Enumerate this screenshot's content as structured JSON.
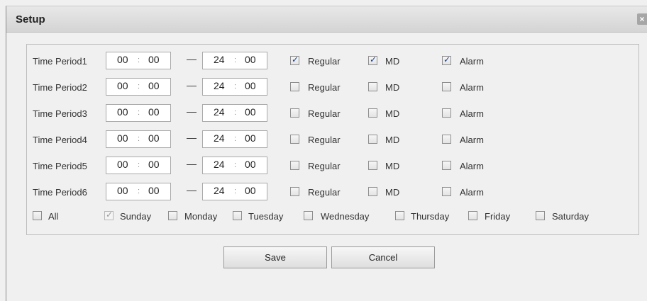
{
  "dialog": {
    "title": "Setup",
    "close_glyph": "×"
  },
  "time_periods": [
    {
      "label": "Time Period1",
      "start_h": "00",
      "start_m": "00",
      "end_h": "24",
      "end_m": "00",
      "regular": true,
      "md": true,
      "alarm": true
    },
    {
      "label": "Time Period2",
      "start_h": "00",
      "start_m": "00",
      "end_h": "24",
      "end_m": "00",
      "regular": false,
      "md": false,
      "alarm": false
    },
    {
      "label": "Time Period3",
      "start_h": "00",
      "start_m": "00",
      "end_h": "24",
      "end_m": "00",
      "regular": false,
      "md": false,
      "alarm": false
    },
    {
      "label": "Time Period4",
      "start_h": "00",
      "start_m": "00",
      "end_h": "24",
      "end_m": "00",
      "regular": false,
      "md": false,
      "alarm": false
    },
    {
      "label": "Time Period5",
      "start_h": "00",
      "start_m": "00",
      "end_h": "24",
      "end_m": "00",
      "regular": false,
      "md": false,
      "alarm": false
    },
    {
      "label": "Time Period6",
      "start_h": "00",
      "start_m": "00",
      "end_h": "24",
      "end_m": "00",
      "regular": false,
      "md": false,
      "alarm": false
    }
  ],
  "labels": {
    "regular": "Regular",
    "md": "MD",
    "alarm": "Alarm",
    "time_sep": ":",
    "range_dash": "—"
  },
  "days": {
    "all": {
      "label": "All",
      "checked": false
    },
    "list": [
      {
        "label": "Sunday",
        "checked": true,
        "disabled": true
      },
      {
        "label": "Monday",
        "checked": false,
        "disabled": false
      },
      {
        "label": "Tuesday",
        "checked": false,
        "disabled": false
      },
      {
        "label": "Wednesday",
        "checked": false,
        "disabled": false
      },
      {
        "label": "Thursday",
        "checked": false,
        "disabled": false
      },
      {
        "label": "Friday",
        "checked": false,
        "disabled": false
      },
      {
        "label": "Saturday",
        "checked": false,
        "disabled": false
      }
    ]
  },
  "buttons": {
    "save": "Save",
    "cancel": "Cancel"
  }
}
